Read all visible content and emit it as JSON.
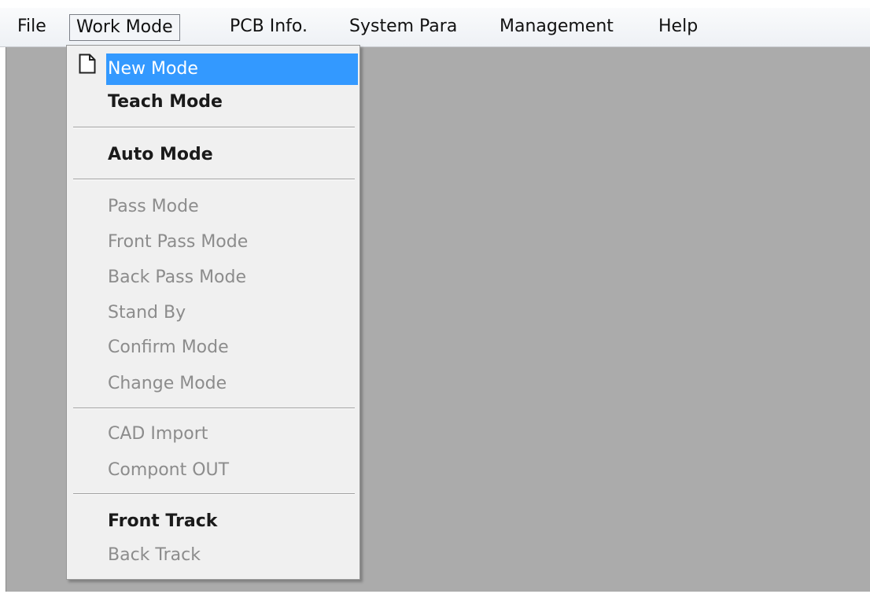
{
  "menubar": {
    "items": [
      {
        "label": "File"
      },
      {
        "label": "Work Mode"
      },
      {
        "label": "PCB Info."
      },
      {
        "label": "System Para"
      },
      {
        "label": "Management"
      },
      {
        "label": "Help"
      }
    ]
  },
  "work_mode_menu": {
    "items": [
      {
        "label": "New Mode",
        "state": "highlighted",
        "icon": "new-document-icon"
      },
      {
        "label": "Teach Mode",
        "state": "enabled"
      },
      {
        "label": "Auto Mode",
        "state": "enabled"
      },
      {
        "label": "Pass Mode",
        "state": "disabled"
      },
      {
        "label": "Front Pass Mode",
        "state": "disabled"
      },
      {
        "label": "Back Pass Mode",
        "state": "disabled"
      },
      {
        "label": "Stand By",
        "state": "disabled"
      },
      {
        "label": "Confirm Mode",
        "state": "disabled"
      },
      {
        "label": "Change Mode",
        "state": "disabled"
      },
      {
        "label": "CAD Import",
        "state": "disabled"
      },
      {
        "label": "Compont OUT",
        "state": "disabled"
      },
      {
        "label": "Front Track",
        "state": "enabled"
      },
      {
        "label": "Back Track",
        "state": "disabled"
      }
    ]
  },
  "colors": {
    "highlight": "#3399ff",
    "workspace": "#ababab",
    "menu_background": "#f0f0f0",
    "disabled_text": "#8c8c8c"
  }
}
